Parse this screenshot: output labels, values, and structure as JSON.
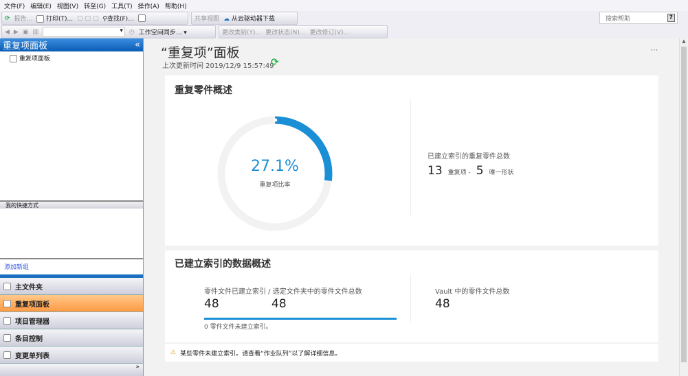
{
  "menu": [
    "文件(F)",
    "编辑(E)",
    "视图(V)",
    "转至(G)",
    "工具(T)",
    "操作(A)",
    "帮助(H)"
  ],
  "toolbar1": {
    "report": "报告...",
    "print": "打印(T)...",
    "find": "查找(F)...",
    "share_view": "共享视图",
    "cloud_download": "从云驱动器下载"
  },
  "toolbar2": {
    "workspace_sync": "工作空间同步...",
    "change_category": "更改类别(Y)...",
    "change_state": "更改状态(N)...",
    "change_revision": "更改修订(V)..."
  },
  "search_help": {
    "placeholder": "搜索帮助",
    "help_icon": "?"
  },
  "left": {
    "title": "重复项面板",
    "collapse": "«",
    "tree_item": "重复项面板",
    "shortcuts_header": "我的快捷方式",
    "add_group": "添加新组",
    "nav": [
      {
        "label": "主文件夹"
      },
      {
        "label": "重复项面板",
        "active": true
      },
      {
        "label": "项目管理器"
      },
      {
        "label": "条目控制"
      },
      {
        "label": "变更单列表"
      }
    ],
    "more": "»"
  },
  "main": {
    "title": "“重复项”面板",
    "updated": "上次更新时间 2019/12/9 15:57:49",
    "more": "···",
    "overview": {
      "title": "重复零件概述",
      "percent": "27.1%",
      "percent_value": 27.1,
      "percent_label": "重复项比率",
      "total_label": "已建立索引的重复零件总数",
      "dup_count": "13",
      "dup_label": "重复项 -",
      "unique_count": "5",
      "unique_label": "唯一形状"
    },
    "indexed": {
      "title": "已建立索引的数据概述",
      "files_label": "零件文件已建立索引 / 选定文件夹中的零件文件总数",
      "indexed_count": "48",
      "total_count": "48",
      "progress": 1.0,
      "not_indexed": "0  零件文件未建立索引。",
      "vault_label": "Vault 中的零件文件总数",
      "vault_count": "48"
    },
    "notice": "某些零件未建立索引。请查看“作业队列”以了解详细信息。"
  },
  "colors": {
    "accent": "#1a8fd6",
    "refresh": "#2db34a",
    "active_nav": "#ffa65a"
  }
}
